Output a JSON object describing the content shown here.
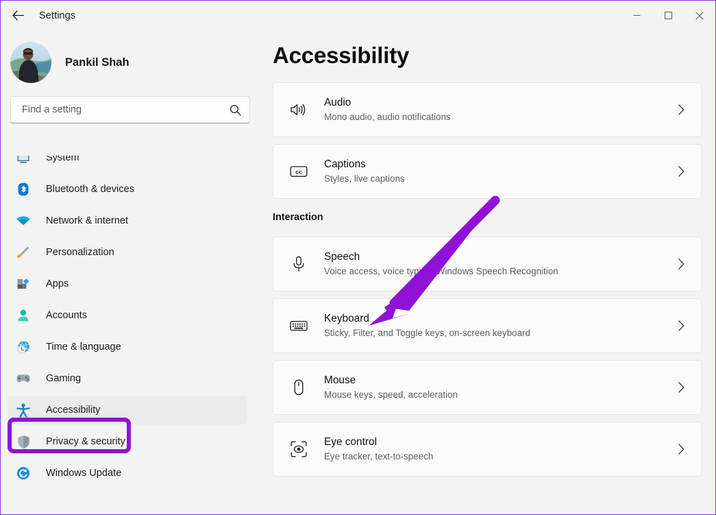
{
  "window": {
    "title": "Settings",
    "back_icon": "back-arrow-icon",
    "controls": {
      "minimize": "minimize-icon",
      "maximize": "maximize-icon",
      "close": "close-icon"
    }
  },
  "sidebar": {
    "profile": {
      "name": "Pankil Shah",
      "avatar": "user-avatar-photo"
    },
    "search": {
      "placeholder": "Find a setting",
      "value": "",
      "icon": "search-icon"
    },
    "items": [
      {
        "label": "System",
        "icon": "system-icon",
        "selected": false,
        "clipped": true
      },
      {
        "label": "Bluetooth & devices",
        "icon": "bluetooth-icon",
        "selected": false
      },
      {
        "label": "Network & internet",
        "icon": "wifi-icon",
        "selected": false
      },
      {
        "label": "Personalization",
        "icon": "paintbrush-icon",
        "selected": false
      },
      {
        "label": "Apps",
        "icon": "apps-icon",
        "selected": false
      },
      {
        "label": "Accounts",
        "icon": "account-icon",
        "selected": false
      },
      {
        "label": "Time & language",
        "icon": "clock-globe-icon",
        "selected": false
      },
      {
        "label": "Gaming",
        "icon": "gamepad-icon",
        "selected": false
      },
      {
        "label": "Accessibility",
        "icon": "accessibility-person-icon",
        "selected": true
      },
      {
        "label": "Privacy & security",
        "icon": "shield-icon",
        "selected": false
      },
      {
        "label": "Windows Update",
        "icon": "update-refresh-icon",
        "selected": false
      }
    ]
  },
  "main": {
    "page_title": "Accessibility",
    "groups": [
      {
        "heading": "",
        "cards": [
          {
            "title": "Audio",
            "subtitle": "Mono audio, audio notifications",
            "icon": "speaker-volume-icon",
            "chevron": "chevron-right-icon"
          },
          {
            "title": "Captions",
            "subtitle": "Styles, live captions",
            "icon": "closed-caption-icon",
            "chevron": "chevron-right-icon"
          }
        ]
      },
      {
        "heading": "Interaction",
        "cards": [
          {
            "title": "Speech",
            "subtitle": "Voice access, voice typing, Windows Speech Recognition",
            "icon": "microphone-icon",
            "chevron": "chevron-right-icon"
          },
          {
            "title": "Keyboard",
            "subtitle": "Sticky, Filter, and Toggle keys, on-screen keyboard",
            "icon": "keyboard-icon",
            "chevron": "chevron-right-icon"
          },
          {
            "title": "Mouse",
            "subtitle": "Mouse keys, speed, acceleration",
            "icon": "mouse-icon",
            "chevron": "chevron-right-icon"
          },
          {
            "title": "Eye control",
            "subtitle": "Eye tracker, text-to-speech",
            "icon": "eye-control-icon",
            "chevron": "chevron-right-icon"
          }
        ]
      }
    ]
  },
  "annotations": {
    "color": "#8f12d6",
    "highlight_target": "Accessibility",
    "arrow_target": "Keyboard"
  }
}
